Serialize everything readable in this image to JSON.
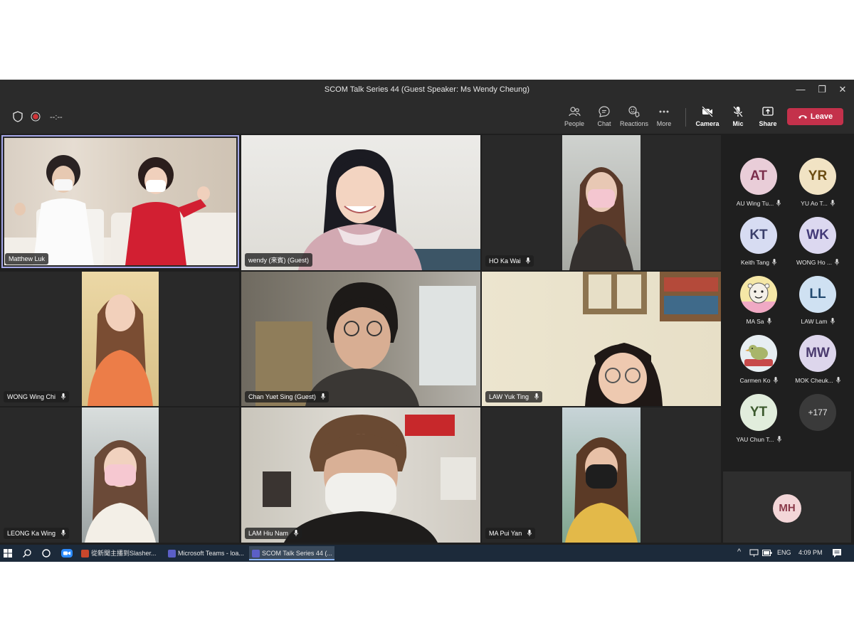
{
  "window": {
    "title": "SCOM Talk Series 44 (Guest Speaker: Ms Wendy Cheung)",
    "controls": [
      "—",
      "❐",
      "✕"
    ]
  },
  "toolbar": {
    "timer": "--:--",
    "buttons": {
      "people": "People",
      "chat": "Chat",
      "reactions": "Reactions",
      "more": "More",
      "camera": "Camera",
      "mic": "Mic",
      "share": "Share"
    },
    "leave_label": "Leave",
    "colors": {
      "leave": "#c4314b",
      "accent": "#a5a7e8"
    }
  },
  "videos": [
    {
      "name": "Matthew Luk",
      "active": true,
      "mic": false
    },
    {
      "name": "wendy (来賓) (Guest)",
      "mic": false
    },
    {
      "name": "HO Ka Wai",
      "mic": true
    },
    {
      "name": "WONG Wing Chi",
      "mic": true
    },
    {
      "name": "Chan Yuet Sing (Guest)",
      "mic": true
    },
    {
      "name": "LAW Yuk Ting",
      "mic": true
    },
    {
      "name": "LEONG Ka Wing",
      "mic": true
    },
    {
      "name": "LAM Hiu Nam",
      "mic": true
    },
    {
      "name": "MA Pui Yan",
      "mic": true
    }
  ],
  "roster": [
    {
      "initials": "AT",
      "name": "AU Wing Tu...",
      "bg": "#e9cdd8",
      "fg": "#7a2d4b"
    },
    {
      "initials": "YR",
      "name": "YU Ao T...",
      "bg": "#f1e3c4",
      "fg": "#6b4c12"
    },
    {
      "initials": "KT",
      "name": "Keith Tang",
      "bg": "#d7dcf2",
      "fg": "#3a3f6b"
    },
    {
      "initials": "WK",
      "name": "WONG Ho ...",
      "bg": "#dcd8f0",
      "fg": "#433a78"
    },
    {
      "initials": "",
      "name": "MA Sa",
      "bg": "#f5e7a6",
      "fg": "#333"
    },
    {
      "initials": "LL",
      "name": "LAW Lam",
      "bg": "#cfe1f2",
      "fg": "#234a70"
    },
    {
      "initials": "",
      "name": "Carmen Ko",
      "bg": "#e7eef2",
      "fg": "#333"
    },
    {
      "initials": "MW",
      "name": "MOK Cheuk...",
      "bg": "#ddd6ec",
      "fg": "#4a3a6e"
    },
    {
      "initials": "YT",
      "name": "YAU Chun T...",
      "bg": "#e1eddc",
      "fg": "#3c5a2e"
    }
  ],
  "overflow_count": "+177",
  "self": {
    "initials": "MH"
  },
  "taskbar": {
    "tasks": [
      "從新聞主播到Slasher...",
      "Microsoft Teams - loa...",
      "SCOM Talk Series 44 (..."
    ],
    "lang": "ENG",
    "time": "4:09 PM"
  }
}
